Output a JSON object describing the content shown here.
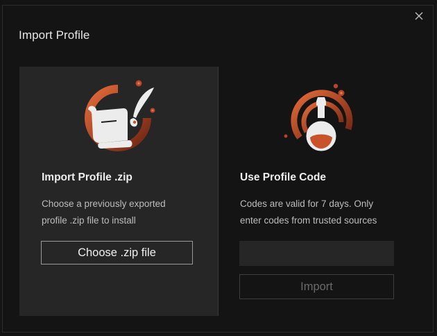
{
  "dialog": {
    "title": "Import Profile",
    "close_icon": "close-icon"
  },
  "zip_panel": {
    "icon": "scroll-quill-icon",
    "heading": "Import Profile .zip",
    "description_line1": "Choose a previously exported",
    "description_line2": "profile .zip file to install",
    "button_label": "Choose .zip file"
  },
  "code_panel": {
    "icon": "potion-bottle-icon",
    "heading": "Use Profile Code",
    "description_line1": "Codes are valid for 7 days. Only",
    "description_line2": "enter codes from trusted sources",
    "input_value": "",
    "import_label": "Import"
  },
  "colors": {
    "accent": "#c8532a",
    "background": "#141414",
    "panel": "#262626"
  }
}
